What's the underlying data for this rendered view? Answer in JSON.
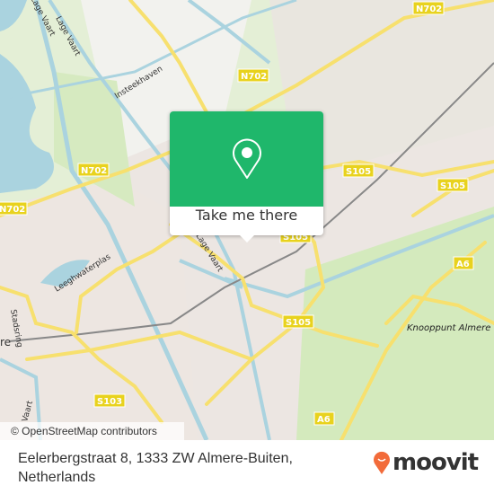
{
  "map": {
    "road_shields": {
      "n702_a": "N702",
      "n702_b": "N702",
      "n702_c": "N702",
      "n702_d": "N702",
      "s105_a": "S105",
      "s105_b": "S105",
      "s105_c": "S105",
      "s105_d": "S105",
      "a6_a": "A6",
      "a6_b": "A6",
      "s103": "S103"
    },
    "place_labels": {
      "lage_vaart_top": "Lage Vaart",
      "lage_vaart_left": "Lage Vaart",
      "lage_vaart_mid": "Lage Vaart",
      "insteekhaven": "Insteekhaven",
      "leeghwaterplas": "Leeghwaterplas",
      "stadsring": "Stadsring",
      "knooppunt": "Knooppunt Almere",
      "almere_fragment": "re",
      "vaart_bottom": "Vaart"
    },
    "colors": {
      "water": "#aad3df",
      "road": "#f7e06e",
      "shield": "#e8d21d",
      "green": "#cfe6b4",
      "urban": "#ece4e0"
    },
    "attribution": "© OpenStreetMap contributors"
  },
  "popup": {
    "icon": "map-pin-icon",
    "button_label": "Take me there",
    "color": "#1fb76b"
  },
  "footer": {
    "address_line1": "Eelerbergstraat 8, 1333 ZW Almere-Buiten,",
    "address_line2": "Netherlands",
    "logo_text": "moovit",
    "logo_color": "#f26b3a"
  }
}
